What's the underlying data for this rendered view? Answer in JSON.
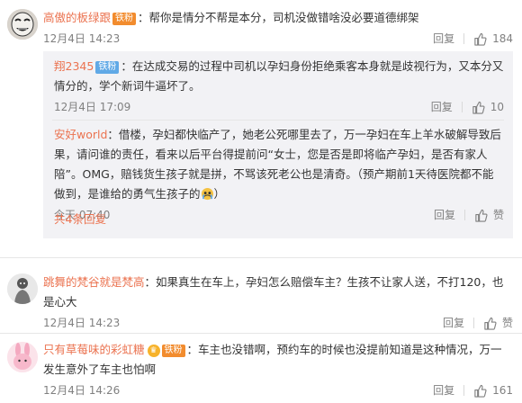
{
  "comments": [
    {
      "username": "高傲的板绿跟",
      "badge": "铁粉",
      "text": "：帮你是情分不帮是本分，司机没做错啥没必要道德绑架",
      "time": "12月4日 14:23",
      "reply_label": "回复",
      "likes": "184",
      "avatar_icon": "meme-face-avatar"
    },
    {
      "username": "跳舞的梵谷就是梵高",
      "text": "：如果真生在车上，孕妇怎么赔偿车主？生孩不让家人送，不打120，也是心大",
      "time": "12月4日 14:23",
      "reply_label": "回复",
      "likes": "赞",
      "avatar_icon": "cartoon-figure-avatar"
    },
    {
      "username": "只有草莓味的彩虹糖",
      "badge": "铁粉",
      "text": "：车主也没错啊，预约车的时候也没提前知道是这种情况，万一发生意外了车主也怕啊",
      "time": "12月4日 14:26",
      "reply_label": "回复",
      "likes": "161",
      "avatar_icon": "pink-rabbit-avatar"
    }
  ],
  "replies": [
    {
      "username": "翔2345",
      "badge": "铁粉",
      "text": "：在达成交易的过程中司机以孕妇身份拒绝乘客本身就是歧视行为，又本分又情分的，学个新词牛逼坏了。",
      "time": "12月4日 17:09",
      "reply_label": "回复",
      "likes": "10"
    },
    {
      "username": "安好world",
      "text": "：借楼，孕妇都快临产了，她老公死哪里去了，万一孕妇在车上羊水破解导致后果，请问谁的责任，看来以后平台得提前问“女士，您是否是即将临产孕妇，是否有家人陪”。OMG，赔钱货生孩子就是拼，不骂该死老公也是清奇。（预产期前1天待医院都不能做到，是谁给的勇气生孩子的",
      "emoji": "crying-emoji",
      "text_end": "）",
      "time": "今天 07:40",
      "reply_label": "回复",
      "likes": "赞"
    }
  ],
  "more_replies": "共4条回复",
  "colors": {
    "username": "#eb7350",
    "reply_bg": "#f2f2f5",
    "badge_orange": "#f28c2e",
    "badge_blue": "#60a9e6"
  }
}
